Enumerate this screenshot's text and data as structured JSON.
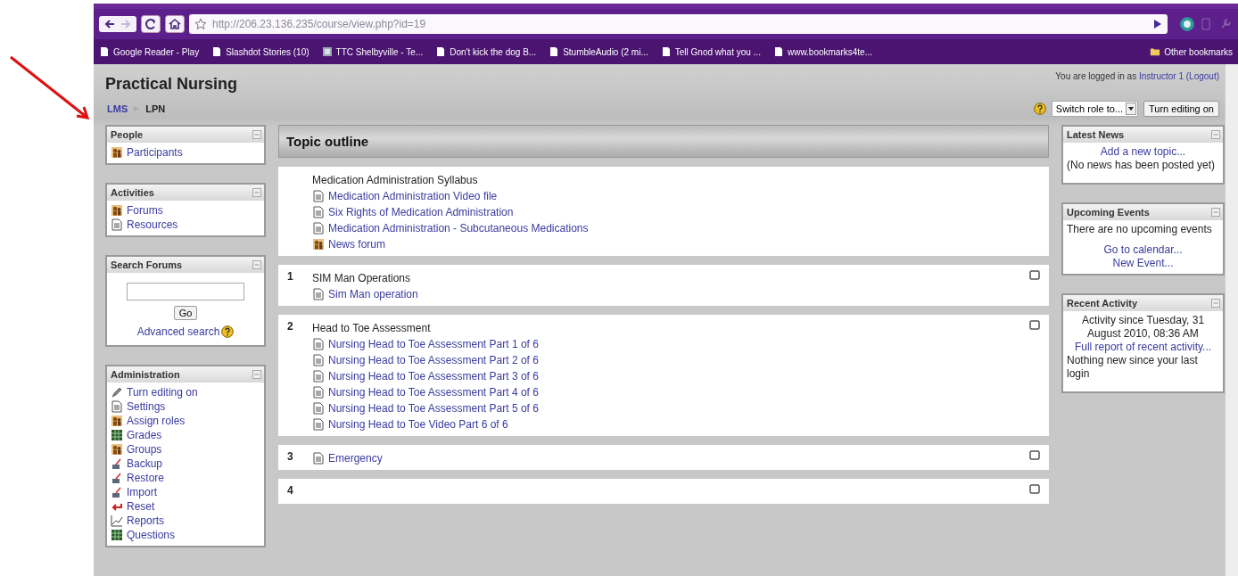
{
  "browser": {
    "url": "http://206.23.136.235/course/view.php?id=19",
    "bookmarks": [
      {
        "label": "Google Reader - Play",
        "kind": "page"
      },
      {
        "label": "Slashdot Stories (10)",
        "kind": "page"
      },
      {
        "label": "TTC Shelbyville - Te...",
        "kind": "site"
      },
      {
        "label": "Don't kick the dog B...",
        "kind": "page"
      },
      {
        "label": "StumbleAudio (2 mi...",
        "kind": "page"
      },
      {
        "label": "Tell Gnod what you ...",
        "kind": "page"
      },
      {
        "label": "www.bookmarks4te...",
        "kind": "page"
      }
    ],
    "other_bookmarks": "Other bookmarks"
  },
  "header": {
    "title": "Practical Nursing",
    "login_prefix": "You are logged in as",
    "user": "Instructor 1",
    "logout": "(Logout)"
  },
  "breadcrumb": [
    {
      "label": "LMS",
      "kind": "link"
    },
    {
      "label": "LPN",
      "kind": "current"
    }
  ],
  "controls": {
    "switch_role": "Switch role to...",
    "editing_button": "Turn editing on"
  },
  "left_blocks": [
    {
      "title": "People",
      "kind": "links",
      "items": [
        {
          "label": "Participants",
          "kind": "people"
        }
      ]
    },
    {
      "title": "Activities",
      "kind": "links",
      "items": [
        {
          "label": "Forums",
          "kind": "people"
        },
        {
          "label": "Resources",
          "kind": "page"
        }
      ]
    },
    {
      "title": "Search Forums",
      "kind": "search",
      "button": "Go",
      "advanced": "Advanced search"
    },
    {
      "title": "Administration",
      "kind": "links",
      "items": [
        {
          "label": "Turn editing on",
          "kind": "pen"
        },
        {
          "label": "Settings",
          "kind": "page"
        },
        {
          "label": "Assign roles",
          "kind": "people"
        },
        {
          "label": "Grades",
          "kind": "grid"
        },
        {
          "label": "Groups",
          "kind": "people"
        },
        {
          "label": "Backup",
          "kind": "tool"
        },
        {
          "label": "Restore",
          "kind": "tool"
        },
        {
          "label": "Import",
          "kind": "tool"
        },
        {
          "label": "Reset",
          "kind": "undo"
        },
        {
          "label": "Reports",
          "kind": "chart"
        },
        {
          "label": "Questions",
          "kind": "grid"
        }
      ]
    }
  ],
  "course": {
    "heading": "Topic outline",
    "sections": [
      {
        "summary": "Medication Administration Syllabus",
        "items": [
          {
            "label": "Medication Administration Video file",
            "kind": "page"
          },
          {
            "label": "Six Rights of Medication Administration",
            "kind": "page"
          },
          {
            "label": "Medication Administration - Subcutaneous Medications",
            "kind": "page"
          },
          {
            "label": "News forum",
            "kind": "forum"
          }
        ]
      },
      {
        "number": "1",
        "summary": "SIM Man Operations",
        "items": [
          {
            "label": "Sim Man operation",
            "kind": "page"
          }
        ]
      },
      {
        "number": "2",
        "summary": "Head to Toe Assessment",
        "items": [
          {
            "label": "Nursing Head to Toe Assessment Part 1 of 6",
            "kind": "page"
          },
          {
            "label": "Nursing Head to Toe Assessment Part 2 of 6",
            "kind": "page"
          },
          {
            "label": "Nursing Head to Toe Assessment Part 3 of 6",
            "kind": "page"
          },
          {
            "label": "Nursing Head to Toe Assessment Part 4 of 6",
            "kind": "page"
          },
          {
            "label": "Nursing Head to Toe Assessment Part 5 of 6",
            "kind": "page"
          },
          {
            "label": "Nursing Head to Toe Video Part 6 of 6",
            "kind": "page"
          }
        ]
      },
      {
        "number": "3",
        "items": [
          {
            "label": "Emergency",
            "kind": "page"
          }
        ]
      },
      {
        "number": "4"
      }
    ]
  },
  "right_blocks": [
    {
      "title": "Latest News",
      "lines": [
        {
          "text": "Add a new topic...",
          "kind": "link"
        },
        {
          "text": "(No news has been posted yet)",
          "kind": "text"
        }
      ]
    },
    {
      "title": "Upcoming Events",
      "lines": [
        {
          "text": "There are no upcoming events",
          "kind": "text"
        },
        {
          "text": "Go to calendar...",
          "kind": "link"
        },
        {
          "text": "New Event...",
          "kind": "link"
        }
      ]
    },
    {
      "title": "Recent Activity",
      "lines": [
        {
          "text": "Activity since Tuesday, 31 August 2010, 08:36 AM",
          "kind": "centered_text"
        },
        {
          "text": "Full report of recent activity...",
          "kind": "link"
        },
        {
          "text": "Nothing new since your last login",
          "kind": "text"
        }
      ]
    }
  ]
}
